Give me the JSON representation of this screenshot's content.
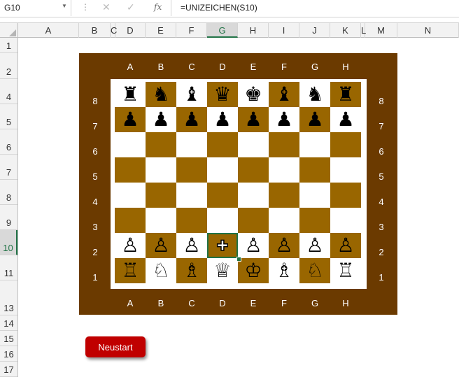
{
  "formula_bar": {
    "name_box": "G10",
    "fx_label": "fx",
    "formula": "=UNIZEICHEN(S10)"
  },
  "columns": [
    "A",
    "B",
    "C",
    "D",
    "E",
    "F",
    "G",
    "H",
    "I",
    "J",
    "K",
    "L",
    "M",
    "N"
  ],
  "selected_column": "G",
  "rows": [
    "1",
    "2",
    "4",
    "5",
    "6",
    "7",
    "8",
    "9",
    "10",
    "11",
    "13",
    "14",
    "15",
    "16",
    "17"
  ],
  "selected_row": "10",
  "board": {
    "files": [
      "A",
      "B",
      "C",
      "D",
      "E",
      "F",
      "G",
      "H"
    ],
    "ranks": [
      "8",
      "7",
      "6",
      "5",
      "4",
      "3",
      "2",
      "1"
    ],
    "pieces": [
      [
        "♜",
        "♞",
        "♝",
        "♛",
        "♚",
        "♝",
        "♞",
        "♜"
      ],
      [
        "♟",
        "♟",
        "♟",
        "♟",
        "♟",
        "♟",
        "♟",
        "♟"
      ],
      [
        "",
        "",
        "",
        "",
        "",
        "",
        "",
        ""
      ],
      [
        "",
        "",
        "",
        "",
        "",
        "",
        "",
        ""
      ],
      [
        "",
        "",
        "",
        "",
        "",
        "",
        "",
        ""
      ],
      [
        "",
        "",
        "",
        "",
        "",
        "",
        "",
        ""
      ],
      [
        "♙",
        "♙",
        "♙",
        "✚",
        "♙",
        "♙",
        "♙",
        "♙"
      ],
      [
        "♖",
        "♘",
        "♗",
        "♕",
        "♔",
        "♗",
        "♘",
        "♖"
      ]
    ],
    "selected_square": "D2",
    "light_color": "#ffffff",
    "dark_color": "#996600",
    "frame_color": "#6b3a00"
  },
  "restart_button": {
    "label": "Neustart",
    "color": "#c00000"
  }
}
